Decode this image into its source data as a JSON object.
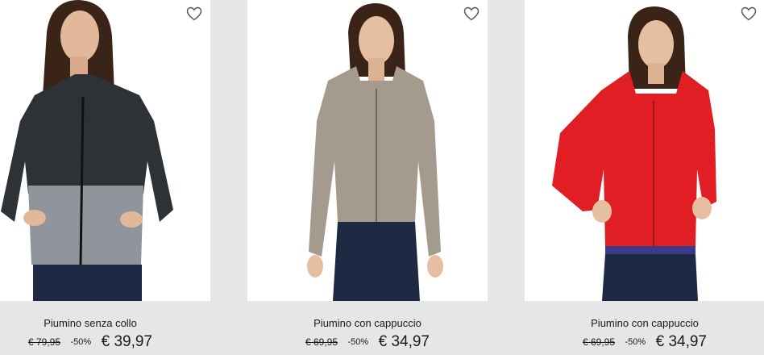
{
  "products": [
    {
      "name": "Piumino senza collo",
      "old_price": "€ 79,95",
      "discount": "-50%",
      "price": "€ 39,97",
      "jacket_color": "#2e3236",
      "jacket_color_2": "#8f959b"
    },
    {
      "name": "Piumino con cappuccio",
      "old_price": "€ 69,95",
      "discount": "-50%",
      "price": "€ 34,97",
      "jacket_color": "#a59a8e"
    },
    {
      "name": "Piumino con cappuccio",
      "old_price": "€ 69,95",
      "discount": "-50%",
      "price": "€ 34,97",
      "jacket_color": "#e01e24"
    }
  ],
  "icons": {
    "wishlist": "heart-outline-icon"
  }
}
